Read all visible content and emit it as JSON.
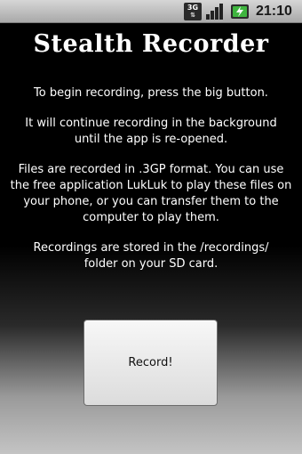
{
  "status_bar": {
    "network_label": "3G",
    "signal_icon": "signal-bars-icon",
    "battery_icon": "battery-charging-icon",
    "time": "21:10"
  },
  "app": {
    "title": "Stealth Recorder",
    "paragraphs": [
      "To begin recording, press the big button.",
      "It will continue recording in the background\nuntil the app is re-opened.",
      "Files are recorded in .3GP format. You can use\nthe free application LukLuk to play these files on\nyour phone, or you can transfer them to the\ncomputer to play them.",
      "Recordings are stored in the /recordings/\nfolder on your SD card."
    ],
    "record_button_label": "Record!"
  },
  "colors": {
    "background": "#000000",
    "text": "#ffffff",
    "button_face": "#ececec"
  }
}
